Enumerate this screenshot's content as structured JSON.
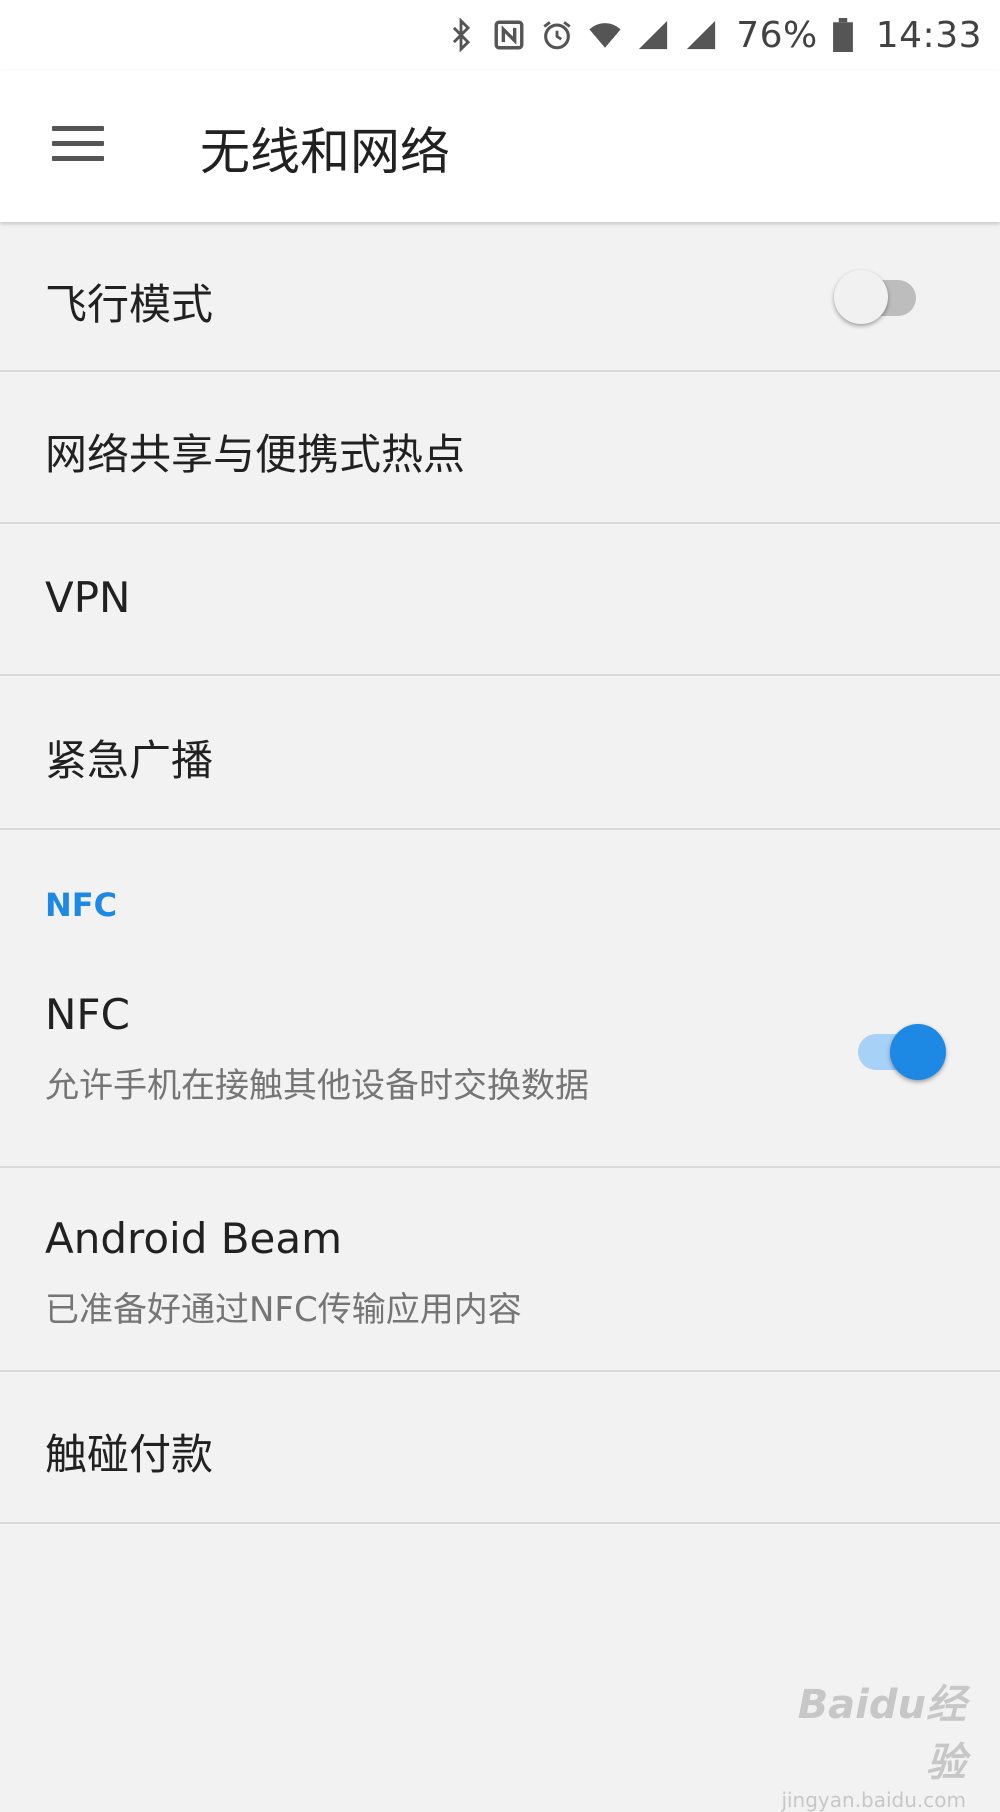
{
  "status_bar": {
    "icons": [
      "bluetooth-icon",
      "nfc-icon",
      "alarm-icon",
      "wifi-icon",
      "signal-icon",
      "signal-icon-2",
      "battery-icon"
    ],
    "battery_percent": "76%",
    "time": "14:33"
  },
  "app_bar": {
    "menu_icon": "menu-icon",
    "title": "无线和网络"
  },
  "settings": {
    "airplane": {
      "label": "飞行模式",
      "enabled": false
    },
    "tethering": {
      "label": "网络共享与便携式热点"
    },
    "vpn": {
      "label": "VPN"
    },
    "cell_broadcast": {
      "label": "紧急广播"
    },
    "nfc_section_header": "NFC",
    "nfc": {
      "label": "NFC",
      "summary": "允许手机在接触其他设备时交换数据",
      "enabled": true
    },
    "android_beam": {
      "label": "Android Beam",
      "summary": "已准备好通过NFC传输应用内容"
    },
    "tap_pay": {
      "label": "触碰付款"
    }
  },
  "colors": {
    "accent": "#1e88e5",
    "switch_on_track": "#a8d1f7",
    "background": "#f2f2f2"
  },
  "watermark": {
    "main": "Baidu经验",
    "sub": "jingyan.baidu.com"
  }
}
